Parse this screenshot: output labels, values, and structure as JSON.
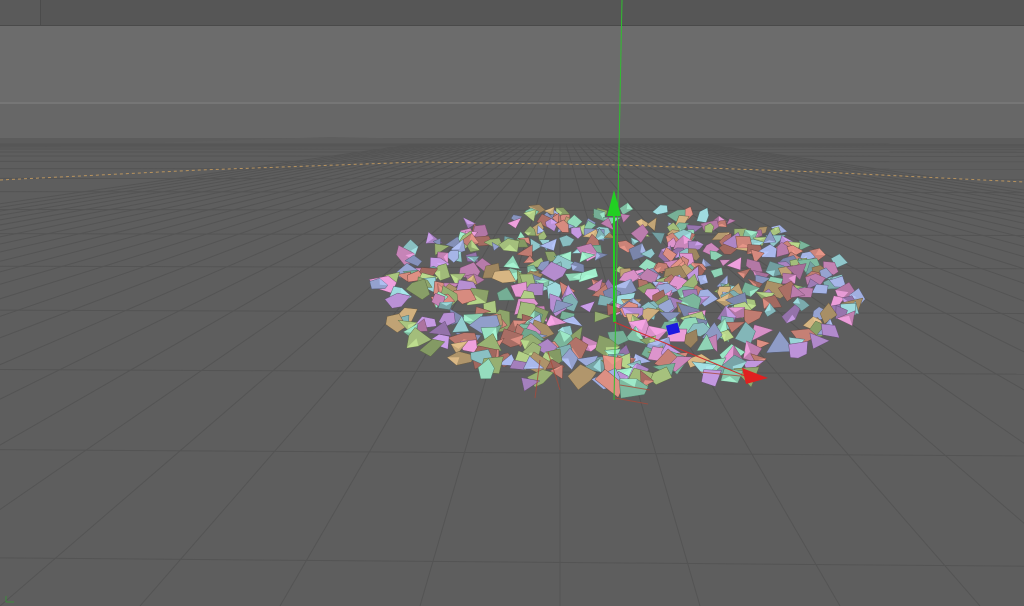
{
  "viewport": {
    "background_color": "#5c5c5c",
    "sky_color": "#6b6b6b",
    "floor_color": "#5e5e5e",
    "grid_color": "#525252",
    "horizon_line_color": "#7d7d7d",
    "floor_edge_color": "#c9a06a"
  },
  "gizmo": {
    "y_axis_color": "#22c422",
    "x_axis_color": "#e02020",
    "z_axis_color": "#2020e0",
    "y_axis_icon": "arrow-up-icon",
    "x_axis_icon": "arrow-right-icon"
  },
  "debris": {
    "palette": [
      "#c98277",
      "#b58dd0",
      "#c5a778",
      "#8fc6c9",
      "#a7c27e",
      "#d48ec4",
      "#9ba9d8",
      "#8fd4b6"
    ]
  }
}
